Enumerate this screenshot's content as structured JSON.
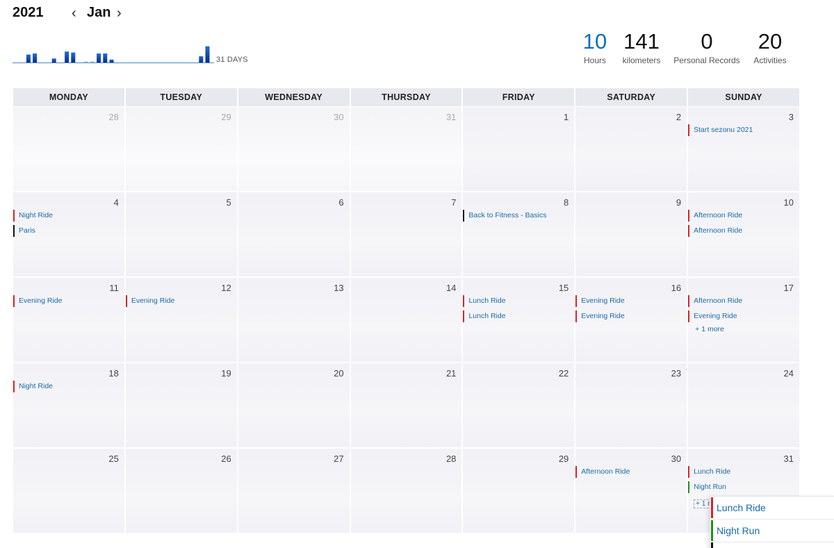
{
  "header": {
    "year": "2021",
    "month": "Jan",
    "prev_icon": "chevron-left",
    "next_icon": "chevron-right"
  },
  "sparkline": {
    "label": "31 DAYS",
    "bars": [
      0,
      0,
      0.32,
      0.36,
      0,
      0,
      0.16,
      0,
      0.44,
      0.4,
      0,
      0.04,
      0.04,
      0.36,
      0.36,
      0.12,
      0,
      0,
      0,
      0,
      0,
      0,
      0,
      0,
      0,
      0,
      0,
      0,
      0,
      0.25,
      0.65
    ]
  },
  "stats": [
    {
      "value": "10",
      "label": "Hours"
    },
    {
      "value": "141",
      "label": "kilometers"
    },
    {
      "value": "0",
      "label": "Personal Records"
    },
    {
      "value": "20",
      "label": "Activities"
    }
  ],
  "colors": {
    "ride": "#e02020",
    "run": "#1e8e1e",
    "other": "#111111",
    "link": "#1a6aa8",
    "accent": "#0b6fb8"
  },
  "weekdays": [
    "MONDAY",
    "TUESDAY",
    "WEDNESDAY",
    "THURSDAY",
    "FRIDAY",
    "SATURDAY",
    "SUNDAY"
  ],
  "weeks": [
    [
      {
        "n": "28",
        "other": true,
        "events": []
      },
      {
        "n": "29",
        "other": true,
        "events": []
      },
      {
        "n": "30",
        "other": true,
        "events": []
      },
      {
        "n": "31",
        "other": true,
        "events": []
      },
      {
        "n": "1",
        "events": []
      },
      {
        "n": "2",
        "events": []
      },
      {
        "n": "3",
        "events": [
          {
            "t": "Start sezonu 2021",
            "c": "ride"
          }
        ]
      }
    ],
    [
      {
        "n": "4",
        "events": [
          {
            "t": "Night Ride",
            "c": "ride"
          },
          {
            "t": "Paris",
            "c": "other"
          }
        ]
      },
      {
        "n": "5",
        "events": []
      },
      {
        "n": "6",
        "events": []
      },
      {
        "n": "7",
        "events": []
      },
      {
        "n": "8",
        "events": [
          {
            "t": "Back to Fitness - Basics",
            "c": "other"
          }
        ]
      },
      {
        "n": "9",
        "events": []
      },
      {
        "n": "10",
        "events": [
          {
            "t": "Afternoon Ride",
            "c": "ride"
          },
          {
            "t": "Afternoon Ride",
            "c": "ride"
          }
        ]
      }
    ],
    [
      {
        "n": "11",
        "events": [
          {
            "t": "Evening Ride",
            "c": "ride"
          }
        ]
      },
      {
        "n": "12",
        "events": [
          {
            "t": "Evening Ride",
            "c": "ride"
          }
        ]
      },
      {
        "n": "13",
        "events": []
      },
      {
        "n": "14",
        "events": []
      },
      {
        "n": "15",
        "events": [
          {
            "t": "Lunch Ride",
            "c": "ride"
          },
          {
            "t": "Lunch Ride",
            "c": "ride"
          }
        ]
      },
      {
        "n": "16",
        "events": [
          {
            "t": "Evening Ride",
            "c": "ride"
          },
          {
            "t": "Evening Ride",
            "c": "ride"
          }
        ]
      },
      {
        "n": "17",
        "events": [
          {
            "t": "Afternoon Ride",
            "c": "ride"
          },
          {
            "t": "Evening Ride",
            "c": "ride"
          }
        ],
        "more": "+ 1 more"
      }
    ],
    [
      {
        "n": "18",
        "events": [
          {
            "t": "Night Ride",
            "c": "ride"
          }
        ]
      },
      {
        "n": "19",
        "events": []
      },
      {
        "n": "20",
        "events": []
      },
      {
        "n": "21",
        "events": []
      },
      {
        "n": "22",
        "events": []
      },
      {
        "n": "23",
        "events": []
      },
      {
        "n": "24",
        "events": []
      }
    ],
    [
      {
        "n": "25",
        "events": []
      },
      {
        "n": "26",
        "events": []
      },
      {
        "n": "27",
        "events": []
      },
      {
        "n": "28",
        "events": []
      },
      {
        "n": "29",
        "events": []
      },
      {
        "n": "30",
        "events": [
          {
            "t": "Afternoon Ride",
            "c": "ride"
          }
        ]
      },
      {
        "n": "31",
        "events": [
          {
            "t": "Lunch Ride",
            "c": "ride"
          },
          {
            "t": "Night Run",
            "c": "run"
          }
        ],
        "more": "+ 1 m",
        "more_boxed": true
      }
    ]
  ],
  "popup": {
    "items": [
      {
        "t": "Lunch Ride",
        "c": "ride"
      },
      {
        "t": "Night Run",
        "c": "run"
      }
    ]
  }
}
